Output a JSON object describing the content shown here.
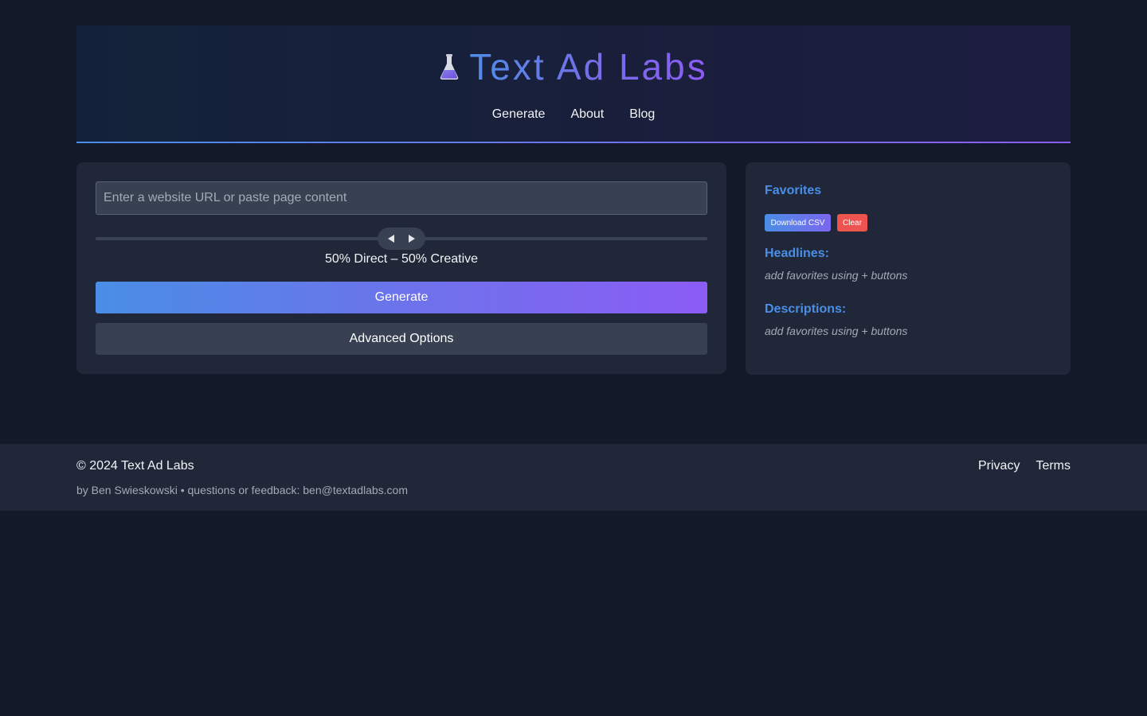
{
  "header": {
    "logo_icon": "flask-icon",
    "title": "Text Ad Labs",
    "nav": [
      "Generate",
      "About",
      "Blog"
    ]
  },
  "generator": {
    "url_placeholder": "Enter a website URL or paste page content",
    "url_value": "",
    "slider": {
      "label": "50% Direct – 50% Creative",
      "value_percent_direct": 50
    },
    "generate_label": "Generate",
    "advanced_label": "Advanced Options"
  },
  "favorites": {
    "title": "Favorites",
    "download_csv_label": "Download CSV",
    "clear_label": "Clear",
    "headlines_title": "Headlines:",
    "headlines_empty": "add favorites using + buttons",
    "descriptions_title": "Descriptions:",
    "descriptions_empty": "add favorites using + buttons"
  },
  "footer": {
    "copyright": "© 2024 Text Ad Labs",
    "byline": "by Ben Swieskowski • questions or feedback: ben@textadlabs.com",
    "links": [
      "Privacy",
      "Terms"
    ]
  },
  "colors": {
    "background": "#131929",
    "panel": "#1f2738",
    "accent_blue": "#4a8ee6",
    "accent_purple": "#8b5cf6",
    "danger": "#ef5350"
  }
}
